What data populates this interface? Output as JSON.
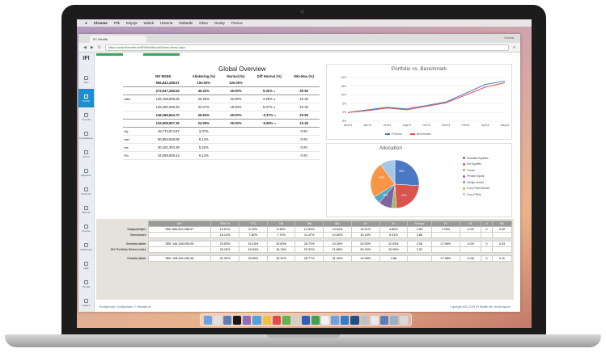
{
  "menubar": {
    "apple": "",
    "items": [
      "Chrome",
      "Plik",
      "Edycja",
      "Widok",
      "Historia",
      "Zakładki",
      "Okno",
      "Osoby",
      "Pomoc"
    ]
  },
  "browser": {
    "tab_title": "IFI Wealth",
    "user_label": "Osoba",
    "url": "https://www.ifiwealth.se/ifi/iWebReportViewer/demo.aspx"
  },
  "sidebar": {
    "logo": "IFI",
    "items": [
      {
        "label": "Start",
        "active": false
      },
      {
        "label": "Portfölj",
        "active": true
      },
      {
        "label": "Översikt",
        "active": false
      },
      {
        "label": "Transaktioner",
        "active": false
      },
      {
        "label": "Export",
        "active": false
      },
      {
        "label": "Rapporter",
        "active": false
      },
      {
        "label": "Dokument",
        "active": false
      },
      {
        "label": "Kalender",
        "active": false
      },
      {
        "label": "Prognos",
        "active": false
      },
      {
        "label": "Inställningar",
        "active": false
      },
      {
        "label": "Hjälp",
        "active": false
      },
      {
        "label": "Kontakt",
        "active": false
      },
      {
        "label": "Logga ut",
        "active": false
      }
    ]
  },
  "overview": {
    "title": "Global Overview",
    "headers": [
      "MV MSEK",
      "Allokering (%)",
      "Normal (%)",
      "Diff Normal (%)",
      "Min-Max (%)"
    ],
    "rows": [
      {
        "label": "",
        "mv": "556,842,288.57",
        "alloc": "100.00%",
        "normal": "100.00%",
        "diff": "",
        "minmax": "",
        "bold": true
      },
      {
        "label": "",
        "mv": "274,647,256.52",
        "alloc": "49.32%",
        "normal": "40.00%",
        "diff": "9.32%",
        "minmax": "30-50",
        "bold": true
      },
      {
        "label": "uities",
        "mv": "146,158,906.06",
        "alloc": "26.25%",
        "normal": "22.00%",
        "diff": "4.25%",
        "minmax": "10-40",
        "bold": false
      },
      {
        "label": "",
        "mv": "128,490,259.46",
        "alloc": "23.07%",
        "normal": "18.00%",
        "diff": "5.07%",
        "minmax": "10-40",
        "bold": false
      },
      {
        "label": "",
        "mv": "148,286,844.70",
        "alloc": "26.63%",
        "normal": "30.00%",
        "diff": "-3.37%",
        "minmax": "20-50",
        "bold": true
      },
      {
        "label": "",
        "mv": "133,908,907.35",
        "alloc": "24.05%",
        "normal": "30.00%",
        "diff": "-5.95%",
        "minmax": "10-40",
        "bold": true
      },
      {
        "label": "uity",
        "mv": "18,772,674.87",
        "alloc": "3.37%",
        "normal": "",
        "diff": "",
        "minmax": "0-20",
        "bold": false
      },
      {
        "label": "nder",
        "mv": "50,884,848.08",
        "alloc": "9.14%",
        "normal": "",
        "diff": "",
        "minmax": "0-20",
        "bold": false
      },
      {
        "label": "nds",
        "mv": "30,182,304.38",
        "alloc": "5.42%",
        "normal": "",
        "diff": "",
        "minmax": "0-20",
        "bold": false
      },
      {
        "label": "FIIs",
        "mv": "34,069,845.44",
        "alloc": "6.12%",
        "normal": "",
        "diff": "",
        "minmax": "0-20",
        "bold": false
      }
    ]
  },
  "portfolio_chart": {
    "title": "Portfolio vs. Benchmark",
    "legend": [
      "Portfolio",
      "Benchmark"
    ],
    "colors": {
      "portfolio": "#4a78c2",
      "benchmark": "#d9534f"
    }
  },
  "allocation_chart": {
    "title": "Allocation",
    "legend": [
      "Swedish Equities",
      "Intl Equities",
      "Fonds",
      "Private Equity",
      "Hedge fonder",
      "Corp Fixed Bonds",
      "Corp FRNs"
    ],
    "colors": [
      "#4a78c2",
      "#d9534f",
      "#9bbb59",
      "#8064a2",
      "#4bacc6",
      "#f79646",
      "#a5c8e6"
    ],
    "slice_labels": [
      "26%",
      "23%",
      "24%",
      "27%"
    ]
  },
  "chart_data": [
    {
      "type": "line",
      "title": "Portfolio vs. Benchmark",
      "x": [
        "Nov/13",
        "Apr/14",
        "Jun/14",
        "Aug/14",
        "Oct/14",
        "Dec/14",
        "Feb/15",
        "Apr/15",
        "May/15"
      ],
      "series": [
        {
          "name": "Portfolio",
          "values": [
            0,
            1.5,
            3,
            2,
            4,
            6,
            11,
            16,
            18
          ]
        },
        {
          "name": "Benchmark",
          "values": [
            0,
            1,
            2.5,
            1.5,
            3.5,
            5.5,
            10,
            14.5,
            17
          ]
        }
      ],
      "ylim": [
        -5,
        20
      ],
      "yticks": [
        "20%",
        "15%",
        "10%",
        "5%",
        "0%",
        "-5%"
      ]
    },
    {
      "type": "pie",
      "title": "Allocation",
      "categories": [
        "Swedish Equities",
        "Intl Equities",
        "Fonds",
        "Private Equity",
        "Hedge fonder",
        "Corp Fixed Bonds",
        "Corp FRNs"
      ],
      "values": [
        26,
        23,
        3,
        9,
        5,
        24,
        10
      ]
    }
  ],
  "bottom_table": {
    "headers": [
      "",
      "MV",
      "SEK %",
      "YTD",
      "1M",
      "3M",
      "6M",
      "1Y",
      "3Y",
      "Sharpe",
      "TE",
      "IR",
      "B",
      "R2"
    ],
    "rows": [
      {
        "name": "Totalportföljen",
        "cells": [
          "SEK 556,842,288.57",
          "14.51%",
          "8.23%",
          "6.36%",
          "12.53%",
          "13.64%",
          "14.51%",
          "4.85%",
          "2.83",
          "7.29%",
          "-0.09",
          "0",
          "0.52"
        ]
      },
      {
        "name": "Benchmark",
        "cells": [
          "",
          "15.14%",
          "7.82%",
          "7.74%",
          "11.47%",
          "12.60%",
          "15.14%",
          "5.31%",
          "2.86",
          "",
          "",
          "",
          ""
        ]
      },
      {
        "name": "",
        "cells": []
      },
      {
        "name": "Svenska aktier",
        "cells": [
          "SEK 146,158,906.06",
          "24.53%",
          "16.15%",
          "15.80%",
          "26.72%",
          "24.26%",
          "24.53%",
          "11.03%",
          "2.06",
          "17.96%",
          "-0.09",
          "0",
          "0.03"
        ]
      },
      {
        "name": "SIX Portfolio Return Index",
        "cells": [
          "",
          "26.15%",
          "16.54%",
          "16.15%",
          "22.92%",
          "21.88%",
          "26.15%",
          "10.96%",
          "2.02",
          "",
          "",
          "",
          ""
        ]
      },
      {
        "name": "",
        "cells": []
      },
      {
        "name": "Globala aktier",
        "cells": [
          "SEK 128,490,259.46",
          "31.33%",
          "15.80%",
          "15.31%",
          "26.77%",
          "31.33%",
          "10.96%",
          "2.68",
          "",
          "17.38%",
          "-0.08",
          "0",
          "0.11"
        ]
      }
    ]
  },
  "statusbar": {
    "left": "Konfigurerad / Konfiguration / © ifiwealth.se",
    "right": "Copyright 2001-2015 IFI Wealth AB | Ändra rapport"
  },
  "dock": {
    "icon_colors": [
      "#6aa2e8",
      "#e0e0e0",
      "#5b7db8",
      "#1a1a1a",
      "#8e6bbf",
      "#4fa3e0",
      "#f0c040",
      "#e04a4a",
      "#5ab552",
      "#d0d0d0",
      "#2b5fb8",
      "#3aa35a",
      "#f0f0f0",
      "#6aa2e8",
      "#2a7fd4",
      "#1f4f8a",
      "#c0c0c0",
      "#e8e8e8",
      "#5b7db8",
      "#9ab0c8",
      "#d8d8d8"
    ]
  }
}
